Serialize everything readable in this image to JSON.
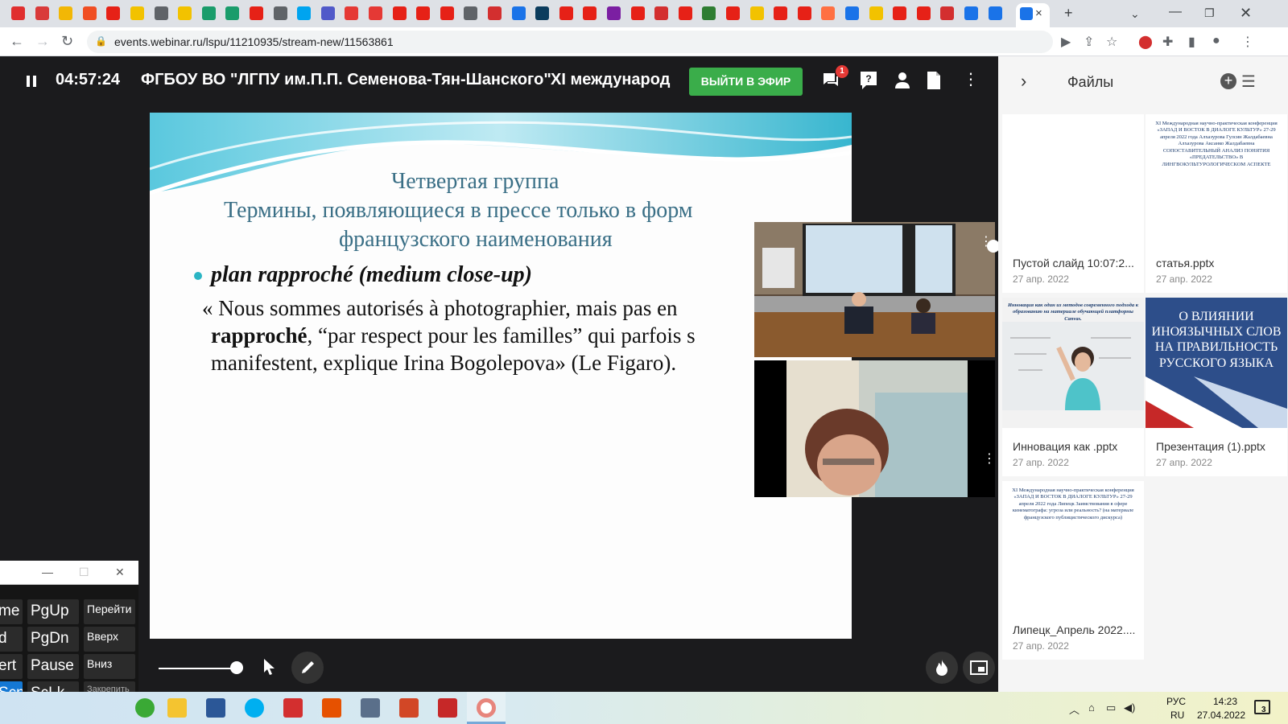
{
  "browser": {
    "url": "events.webinar.ru/lspu/11210935/stream-new/11563861",
    "tab_close": "×",
    "new_tab": "+",
    "tab_icon_colors": [
      "#e02f2f",
      "#d93a3a",
      "#f2b705",
      "#f04e23",
      "#e62117",
      "#f2c200",
      "#5f6368",
      "#f2c200",
      "#1a9c6b",
      "#1a9c6b",
      "#e62117",
      "#5f6368",
      "#00a4ef",
      "#5059c9",
      "#e53935",
      "#e53935",
      "#e62117",
      "#e62117",
      "#e62117",
      "#5f6368",
      "#d32f2f",
      "#1a73e8",
      "#0b3c5d",
      "#e62117",
      "#e62117",
      "#7b1fa2",
      "#e62117",
      "#d32f2f",
      "#e62117",
      "#2e7d32",
      "#e62117",
      "#f2c200",
      "#e62117",
      "#e62117",
      "#ff7043",
      "#1a73e8",
      "#f2c200",
      "#e62117",
      "#e62117",
      "#d32f2f",
      "#1a73e8",
      "#1a73e8"
    ]
  },
  "webinar": {
    "timer": "04:57:24",
    "title": "ФГБОУ ВО \"ЛГПУ им.П.П. Семенова-Тян-Шанского\"",
    "title_cont": "XI международ",
    "live_button": "ВЫЙТИ В ЭФИР",
    "chat_badge": "1"
  },
  "slide": {
    "heading": "Четвертая группа",
    "subheading_line1": "Термины, появляющиеся в прессе только в форм",
    "subheading_line2": "французского наименования",
    "bullet_term": "plan rapproché  (medium close-up)",
    "quote_line1": "« Nous sommes autorisés à photographier, mais pas en",
    "quote_line2_bold": "rapproché",
    "quote_line2_rest": ", “par respect pour les familles” qui parfois s",
    "quote_line3": "manifestent, explique Irina Bogolepova» (Le Figaro)."
  },
  "files_panel": {
    "title": "Файлы",
    "files": [
      {
        "name": "Пустой слайд 10:07:2...",
        "date": "27 апр. 2022"
      },
      {
        "name": "статья.pptx",
        "date": "27 апр. 2022",
        "thumb_text": "XI Международная научно-практическая конференция «ЗАПАД И ВОСТОК В ДИАЛОГЕ КУЛЬТУР» 27-29 апреля 2022 года Алхазурова Гулсин Жалдабаевна Алхазурова Аксанко Жалдабаевна СОПОСТАВИТЕЛЬНЫЙ АНАЛИЗ ПОНЯТИЯ «ПРЕДАТЕЛЬСТВО» В ЛИНГВОКУЛЬТУРОЛОГИЧЕСКОМ АСПЕКТЕ"
      },
      {
        "name": "Инновация как .pptx",
        "date": "27 апр. 2022",
        "thumb_text": "Инновация как один из методов современного подхода к образованию на материале обучающей платформы Canvas."
      },
      {
        "name": "Презентация (1).pptx",
        "date": "27 апр. 2022",
        "thumb_text": "О ВЛИЯНИИ ИНОЯЗЫЧНЫХ СЛОВ НА ПРАВИЛЬНОСТЬ РУССКОГО ЯЗЫКА"
      },
      {
        "name": "Липецк_Апрель 2022....",
        "date": "27 апр. 2022",
        "thumb_text": "XI Международная научно-практическая конференция «ЗАПАД И ВОСТОК В ДИАЛОГЕ КУЛЬТУР» 27-29 апреля 2022 года Липецк Заимствования в сфере кинематографа: угроза или реальность? (на материале французского публицистического дискурса)"
      }
    ]
  },
  "keyboard": {
    "keys": [
      {
        "label": "me",
        "col": 0,
        "row": 0
      },
      {
        "label": "PgUp",
        "col": 1,
        "row": 0
      },
      {
        "label": "Перейти",
        "col": 2,
        "row": 0
      },
      {
        "label": "d",
        "col": 0,
        "row": 1
      },
      {
        "label": "PgDn",
        "col": 1,
        "row": 1
      },
      {
        "label": "Вверх",
        "col": 2,
        "row": 1
      },
      {
        "label": "ert",
        "col": 0,
        "row": 2
      },
      {
        "label": "Pause",
        "col": 1,
        "row": 2
      },
      {
        "label": "Вниз",
        "col": 2,
        "row": 2
      },
      {
        "label": "Scn",
        "col": 0,
        "row": 3
      },
      {
        "label": "ScLk",
        "col": 1,
        "row": 3
      },
      {
        "label": "Закрепить",
        "col": 2,
        "row": 3
      }
    ]
  },
  "taskbar": {
    "lang_top": "РУС",
    "lang_bottom": "RU",
    "time": "14:23",
    "date": "27.04.2022",
    "notif_count": "3"
  }
}
